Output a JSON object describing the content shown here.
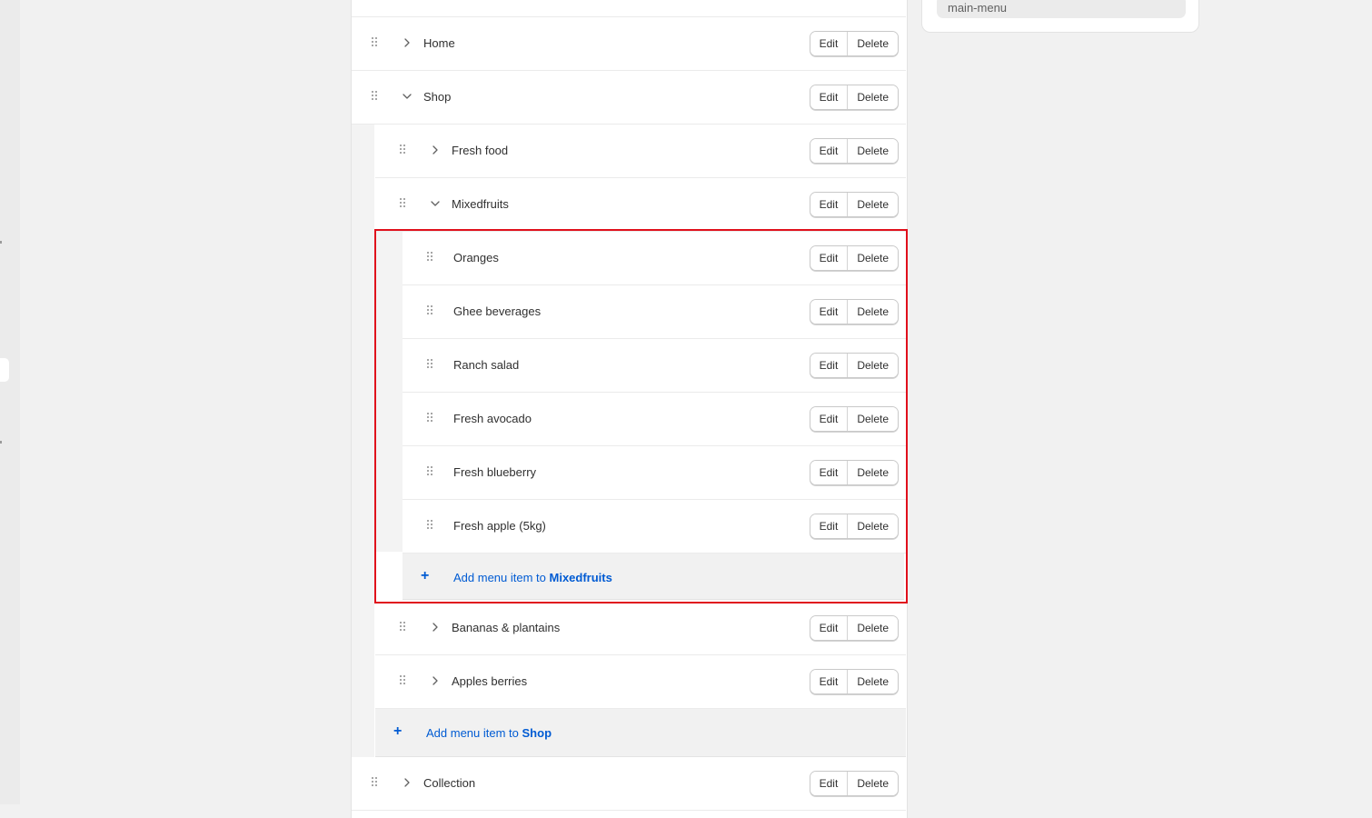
{
  "buttons": {
    "edit": "Edit",
    "delete": "Delete"
  },
  "sidebar_panel": {
    "handle_value": "main-menu"
  },
  "menu": {
    "top": [
      {
        "label": "Home",
        "expanded": false
      },
      {
        "label": "Shop",
        "expanded": true
      },
      {
        "label": "Collection",
        "expanded": false
      }
    ],
    "shop_children": [
      {
        "label": "Fresh food",
        "expanded": false
      },
      {
        "label": "Mixedfruits",
        "expanded": true
      },
      {
        "label": "Bananas & plantains",
        "expanded": false
      },
      {
        "label": "Apples berries",
        "expanded": false
      }
    ],
    "mixedfruits_children": [
      {
        "label": "Oranges"
      },
      {
        "label": "Ghee beverages"
      },
      {
        "label": "Ranch salad"
      },
      {
        "label": "Fresh avocado"
      },
      {
        "label": "Fresh blueberry"
      },
      {
        "label": "Fresh apple (5kg)"
      }
    ],
    "add_to_mixedfruits": {
      "prefix": "Add menu item to",
      "target": "Mixedfruits"
    },
    "add_to_shop": {
      "prefix": "Add menu item to",
      "target": "Shop"
    }
  },
  "colors": {
    "link": "#005bd3",
    "highlight_border": "#e0101c"
  },
  "icons": {
    "handle": "drag-handle-icon",
    "collapsed": "chevron-right-icon",
    "expanded": "chevron-down-icon",
    "add": "plus-icon"
  }
}
